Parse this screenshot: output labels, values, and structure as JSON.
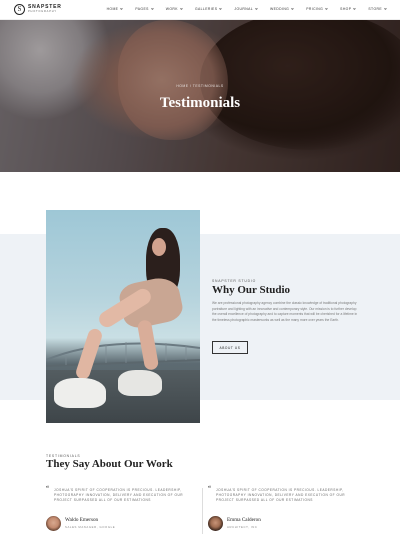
{
  "brand": {
    "name": "SNAPSTER",
    "tagline": "PHOTOGRAPHY",
    "mark": "S"
  },
  "nav": {
    "items": [
      {
        "label": "HOME"
      },
      {
        "label": "PAGES"
      },
      {
        "label": "WORK"
      },
      {
        "label": "GALLERIES"
      },
      {
        "label": "JOURNAL"
      },
      {
        "label": "WEDDING"
      },
      {
        "label": "PRICING"
      },
      {
        "label": "SHOP"
      },
      {
        "label": "STORE"
      }
    ]
  },
  "hero": {
    "breadcrumb": "HOME / TESTIMONIALS",
    "title": "Testimonials"
  },
  "studio": {
    "label": "SNAPSTER STUDIO",
    "title": "Why Our Studio",
    "text": "We are professional photography agency combine the classic knowledge of traditional photography portraiture and lighting with an innovative and contemporary style. Our mission is to further develop the overall excellence of photography and to capture moments that will be cherished for a lifetime in the timeless photographic masterworks as well as the many more over years the Earth.",
    "button": "ABOUT US"
  },
  "testimonials": {
    "label": "TESTIMONIALS",
    "title": "They Say About Our Work",
    "items": [
      {
        "quote_mark": "“",
        "quote": "JOSHUA'S SPIRIT OF COOPERATION IS PRECIOUS. LEADERSHIP, PHOTOGRAPHY INNOVATION, DELIVERY AND EXECUTION OF OUR PROJECT SURPASSED ALL OF OUR ESTIMATIONS",
        "name": "Waldo Emerson",
        "role": "SALES MANAGER, GOOGLE"
      },
      {
        "quote_mark": "“",
        "quote": "JOSHUA'S SPIRIT OF COOPERATION IS PRECIOUS. LEADERSHIP, PHOTOGRAPHY INNOVATION, DELIVERY AND EXECUTION OF OUR PROJECT SURPASSED ALL OF OUR ESTIMATIONS",
        "name": "Emma Calderon",
        "role": "ARCHITECT, INC"
      }
    ]
  }
}
